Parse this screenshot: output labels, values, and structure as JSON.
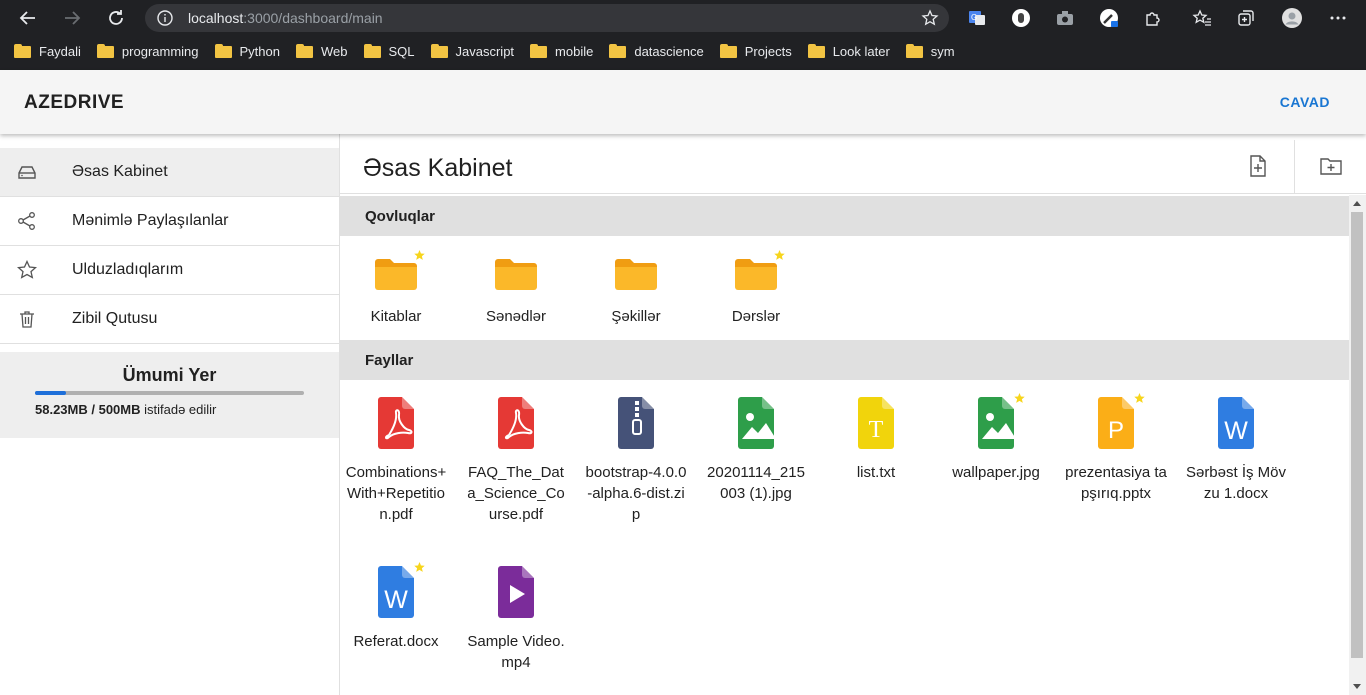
{
  "browser": {
    "url_host": "localhost",
    "url_rest": ":3000/dashboard/main",
    "bookmarks": [
      "Faydali",
      "programming",
      "Python",
      "Web",
      "SQL",
      "Javascript",
      "mobile",
      "datascience",
      "Projects",
      "Look later",
      "sym"
    ]
  },
  "app": {
    "brand": "AZEDRIVE",
    "logout_label": "CAVAD"
  },
  "sidebar": {
    "items": [
      {
        "label": "Əsas Kabinet",
        "icon": "drive-icon"
      },
      {
        "label": "Mənimlə Paylaşılanlar",
        "icon": "share-icon"
      },
      {
        "label": "Ulduzladıqlarım",
        "icon": "star-icon"
      },
      {
        "label": "Zibil Qutusu",
        "icon": "trash-icon"
      }
    ],
    "storage": {
      "title": "Ümumi Yer",
      "used": "58.23MB / 500MB",
      "suffix": "istifadə edilir",
      "used_fraction": 0.1165
    }
  },
  "main": {
    "title": "Əsas Kabinet",
    "folders_heading": "Qovluqlar",
    "files_heading": "Fayllar",
    "folders": [
      {
        "name": "Kitablar",
        "starred": true
      },
      {
        "name": "Sənədlər",
        "starred": false
      },
      {
        "name": "Şəkillər",
        "starred": false
      },
      {
        "name": "Dərslər",
        "starred": true
      }
    ],
    "files": [
      {
        "name": "Combinations+With+Repetition.pdf",
        "type": "pdf",
        "starred": false
      },
      {
        "name": "FAQ_The_Data_Science_Course.pdf",
        "type": "pdf",
        "starred": false
      },
      {
        "name": "bootstrap-4.0.0-alpha.6-dist.zip",
        "type": "zip",
        "starred": false
      },
      {
        "name": "20201114_215003 (1).jpg",
        "type": "image",
        "starred": false
      },
      {
        "name": "list.txt",
        "type": "text",
        "starred": false
      },
      {
        "name": "wallpaper.jpg",
        "type": "image",
        "starred": true
      },
      {
        "name": "prezentasiya tapşırıq.pptx",
        "type": "pptx",
        "starred": true
      },
      {
        "name": "Sərbəst İş Mövzu 1.docx",
        "type": "docx",
        "starred": false
      },
      {
        "name": "Referat.docx",
        "type": "docx",
        "starred": true
      },
      {
        "name": "Sample Video.mp4",
        "type": "video",
        "starred": false
      }
    ]
  },
  "colors": {
    "accent": "#1976d2",
    "folder": "#fbb829",
    "star": "#f7d51d",
    "pdf": "#e53935",
    "zip": "#455278",
    "image": "#2e9e4a",
    "text": "#f1d40c",
    "pptx": "#fbae17",
    "docx": "#2f7de1",
    "video": "#7b2c9a"
  }
}
